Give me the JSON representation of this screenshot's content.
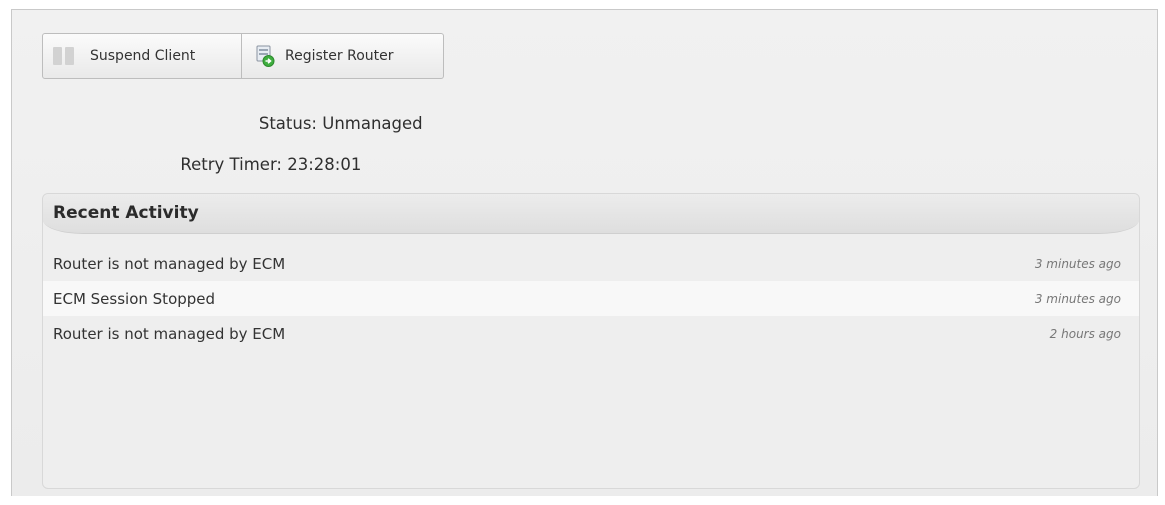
{
  "toolbar": {
    "suspend_label": "Suspend Client",
    "register_label": "Register Router"
  },
  "status": {
    "label": "Status:",
    "value": "Unmanaged"
  },
  "retry": {
    "label": "Retry Timer:",
    "value": "23:28:01"
  },
  "activity": {
    "title": "Recent Activity",
    "items": [
      {
        "message": "Router is not managed by ECM",
        "time": "3 minutes ago"
      },
      {
        "message": "ECM Session Stopped",
        "time": "3 minutes ago"
      },
      {
        "message": "Router is not managed by ECM",
        "time": "2 hours ago"
      }
    ]
  },
  "icons": {
    "suspend": "pause-icon",
    "register": "router-register-icon"
  },
  "colors": {
    "panel_bg": "#efefef",
    "border": "#c9c9c9",
    "register_icon_accent": "#3fae3f"
  }
}
